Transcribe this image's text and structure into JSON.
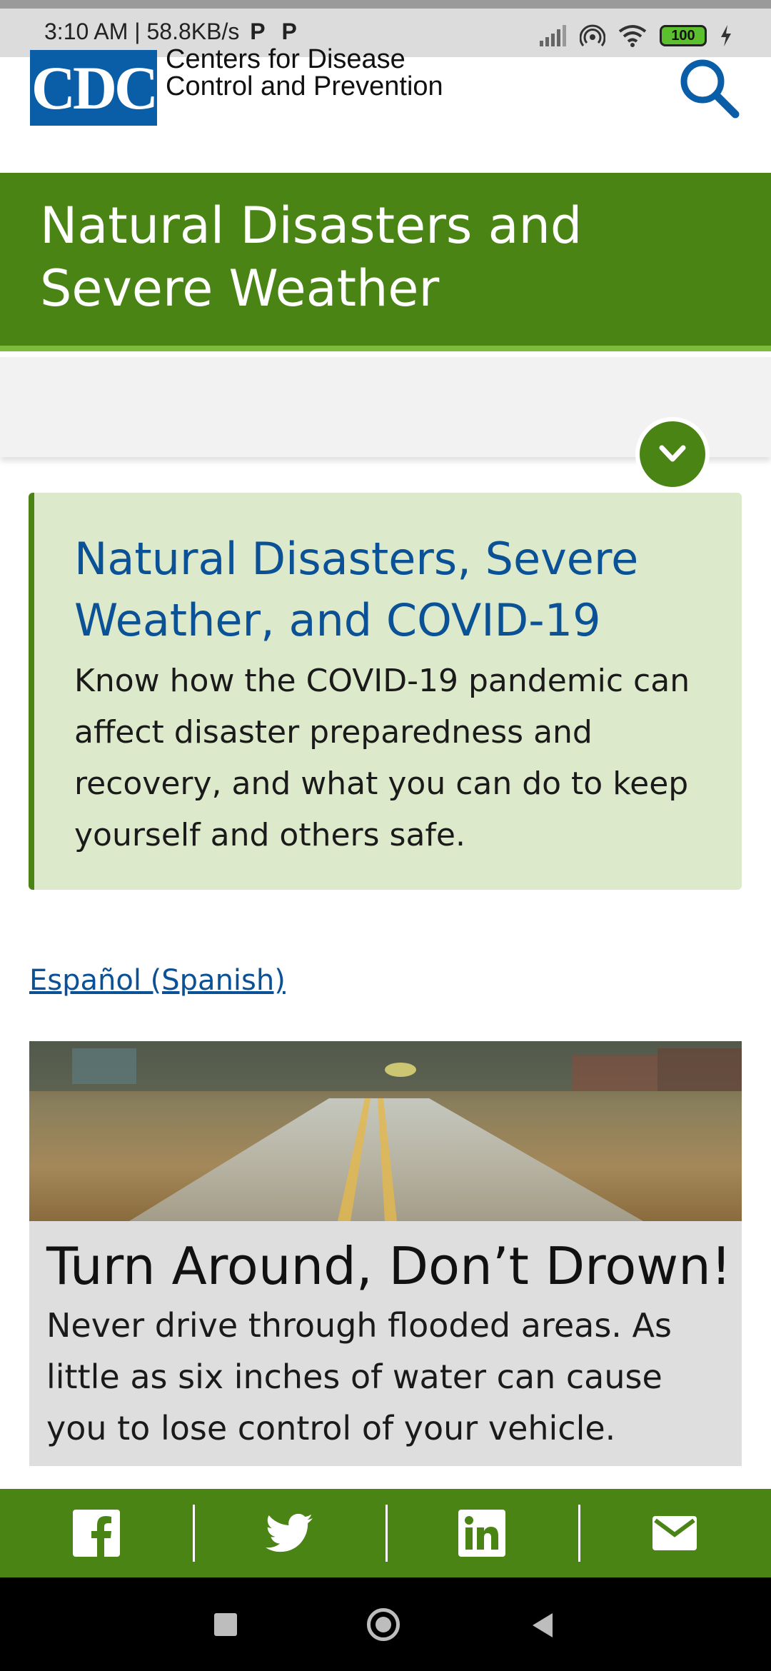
{
  "status_bar": {
    "time": "3:10 AM",
    "speed": "58.8KB/s",
    "battery": "100"
  },
  "header": {
    "logo_text": "CDC",
    "org_line1": "Centers for Disease",
    "org_line2": "Control and Prevention",
    "search_icon": "search-icon"
  },
  "page": {
    "title": "Natural Disasters and Severe Weather"
  },
  "callout": {
    "title": "Natural Disasters, Severe Weather, and COVID-19",
    "body": "Know how the COVID-19 pandemic can affect disaster preparedness and recovery, and what you can do to keep yourself and others safe."
  },
  "language_link": "Español (Spanish)",
  "feature": {
    "title": "Turn Around, Don’t Drown!",
    "body": "Never drive through flooded areas. As little as six inches of water can cause you to lose control of your vehicle."
  },
  "share": {
    "icons": [
      "facebook-icon",
      "twitter-icon",
      "linkedin-icon",
      "email-icon"
    ]
  },
  "colors": {
    "brand_green": "#4a8414",
    "cdc_blue": "#0a5ea8",
    "link_blue": "#0a5196"
  }
}
